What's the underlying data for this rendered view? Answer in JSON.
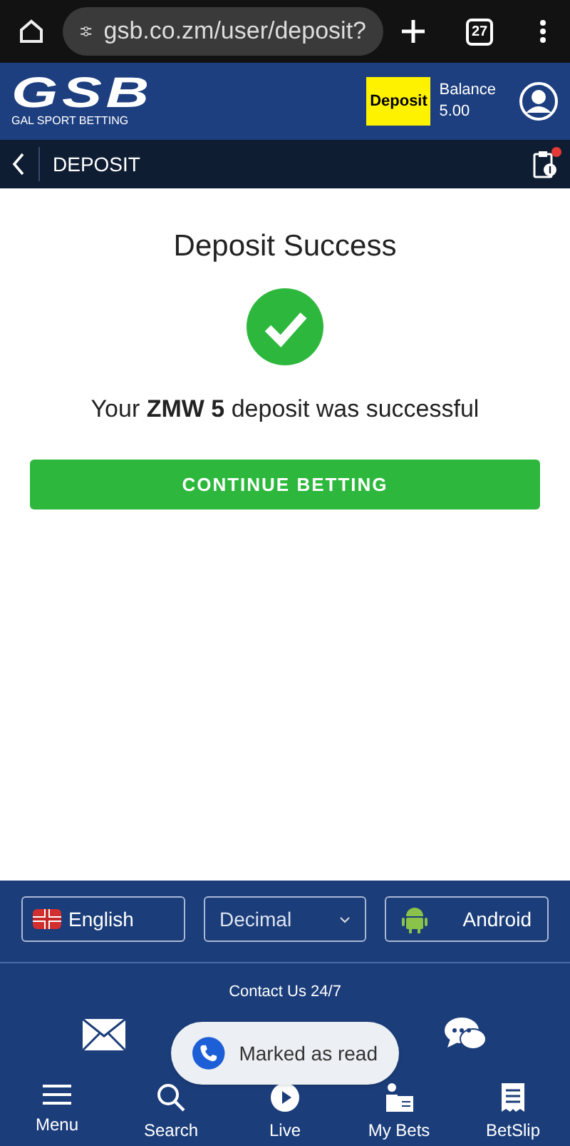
{
  "browser": {
    "url": "gsb.co.zm/user/deposit?",
    "tab_count": "27"
  },
  "header": {
    "logo": "GSB",
    "logo_tagline": "GAL SPORT BETTING",
    "deposit_button": "Deposit",
    "balance_label": "Balance",
    "balance_value": "5.00"
  },
  "subbar": {
    "title": "DEPOSIT",
    "betslip_notification": true
  },
  "content": {
    "heading": "Deposit Success",
    "message": "Your **ZMW 5** deposit was successful",
    "button": "CONTINUE BETTING"
  },
  "footer": {
    "language": "English",
    "odds_format": "Decimal",
    "app": "Android",
    "contact_title": "Contact Us 24/7"
  },
  "toast": {
    "text": "Marked as read"
  },
  "bottom_nav": [
    {
      "label": "Menu",
      "kind": "menu"
    },
    {
      "label": "Search",
      "kind": "search"
    },
    {
      "label": "Live",
      "kind": "live"
    },
    {
      "label": "My Bets",
      "kind": "mybets"
    },
    {
      "label": "BetSlip",
      "kind": "betslip"
    }
  ]
}
